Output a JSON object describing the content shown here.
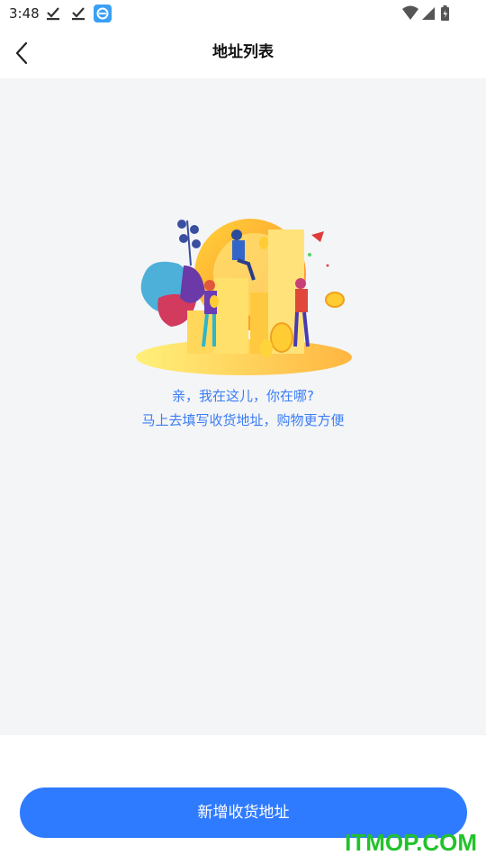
{
  "status_bar": {
    "time": "3:48",
    "icons": [
      "download-done-icon",
      "download-done-icon",
      "app-notification-icon"
    ],
    "right_icons": [
      "wifi-icon",
      "signal-icon",
      "battery-icon"
    ]
  },
  "header": {
    "title": "地址列表",
    "back_icon": "chevron-left-icon"
  },
  "empty_state": {
    "illustration": "empty-address-illustration",
    "line1": "亲，我在这儿，你在哪?",
    "line2": "马上去填写收货地址，购物更方便"
  },
  "footer": {
    "add_button_label": "新增收货地址"
  },
  "watermark": "ITMOP.COM",
  "colors": {
    "accent": "#2f7bff",
    "message": "#3b7df5",
    "background": "#f4f5f7",
    "watermark": "#22c22b"
  }
}
